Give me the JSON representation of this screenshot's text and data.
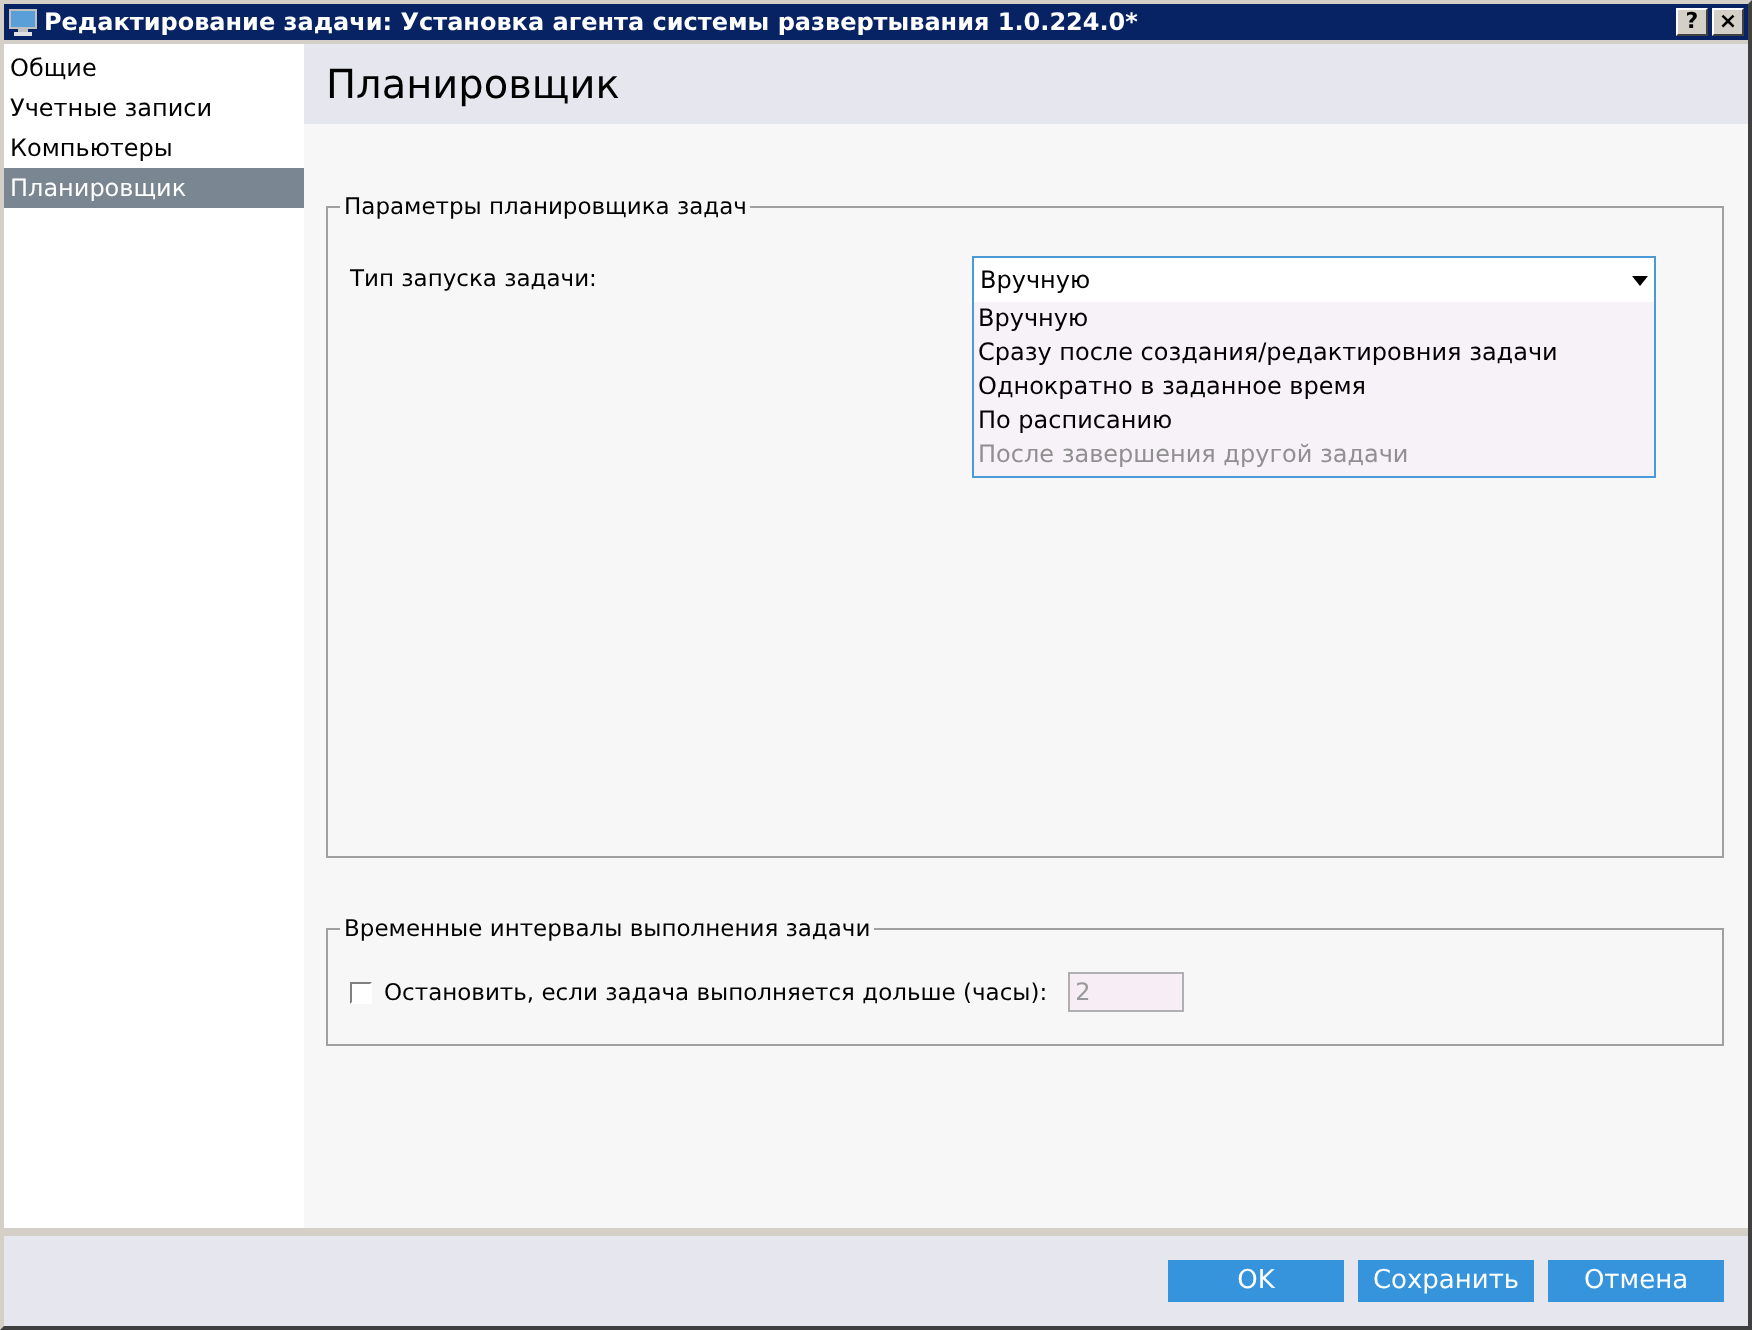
{
  "window": {
    "title": "Редактирование задачи: Установка агента системы развертывания 1.0.224.0*",
    "buttons": [
      {
        "kind": "help",
        "label": "?"
      },
      {
        "kind": "close",
        "label": "×"
      }
    ]
  },
  "sidebar": {
    "items": [
      {
        "label": "Общие",
        "selected": false
      },
      {
        "label": "Учетные записи",
        "selected": false
      },
      {
        "label": "Компьютеры",
        "selected": false
      },
      {
        "label": "Планировщик",
        "selected": true
      }
    ]
  },
  "page_title": "Планировщик",
  "scheduler_group": {
    "title": "Параметры планировщика задач",
    "label": "Тип запуска задачи:",
    "dropdown": {
      "value": "Вручную",
      "expanded": true,
      "options": [
        {
          "label": "Вручную",
          "disabled": false
        },
        {
          "label": "Сразу после создания/редактировния задачи",
          "disabled": false
        },
        {
          "label": "Однократно в заданное время",
          "disabled": false
        },
        {
          "label": "По расписанию",
          "disabled": false
        },
        {
          "label": "После завершения другой задачи",
          "disabled": true
        }
      ]
    }
  },
  "interval_group": {
    "title": "Временные интервалы выполнения задачи",
    "checkbox": {
      "label": "Остановить, если задача выполняется дольше (часы):",
      "checked": false
    },
    "hours": {
      "value": "2",
      "disabled": true
    }
  },
  "buttons": [
    "OK",
    "Сохранить",
    "Отмена"
  ]
}
